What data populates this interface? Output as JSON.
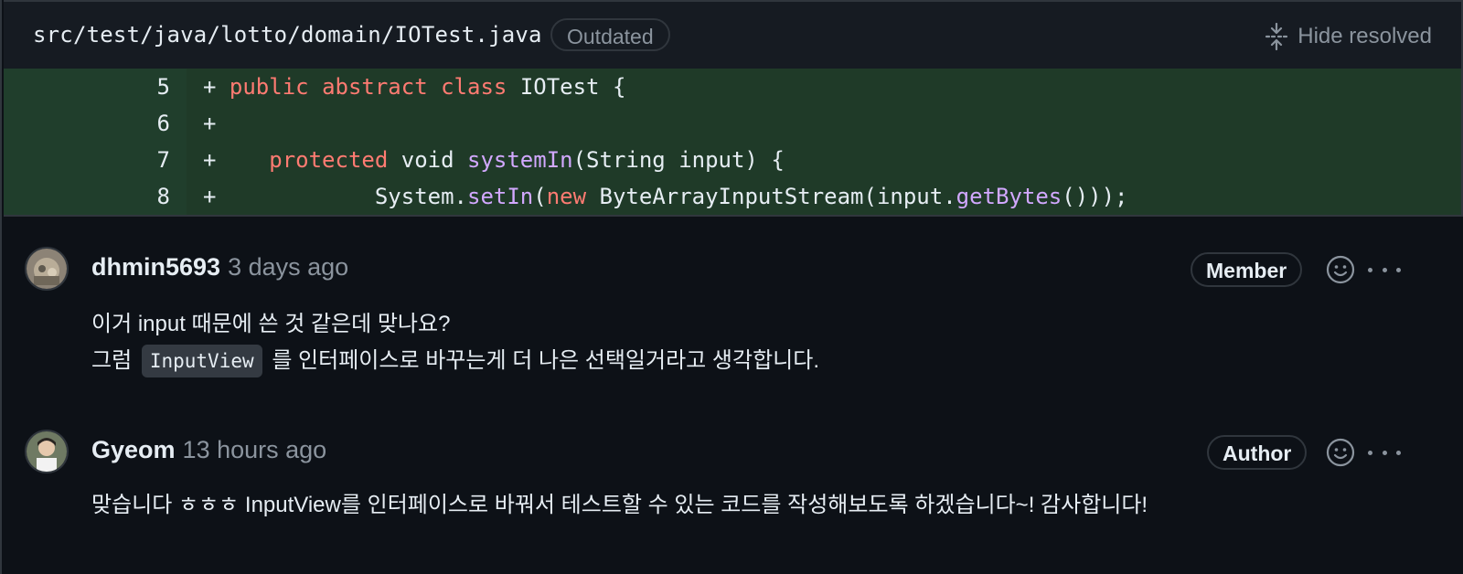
{
  "file": {
    "path": "src/test/java/lotto/domain/IOTest.java",
    "status_badge": "Outdated",
    "hide_resolved_label": "Hide resolved"
  },
  "diff": {
    "lines": [
      {
        "number": "5",
        "marker": "+",
        "code": "public abstract class IOTest {"
      },
      {
        "number": "6",
        "marker": "+",
        "code": ""
      },
      {
        "number": "7",
        "marker": "+",
        "code": "    protected void systemIn(String input) {"
      },
      {
        "number": "8",
        "marker": "+",
        "code": "            System.setIn(new ByteArrayInputStream(input.getBytes()));"
      }
    ]
  },
  "comments": [
    {
      "author": "dhmin5693",
      "time": "3 days ago",
      "role": "Member",
      "line1": "이거 input 때문에 쓴 것 같은데 맞나요?",
      "line2_prefix": "그럼",
      "line2_code": "InputView",
      "line2_suffix": "를 인터페이스로 바꾸는게 더 나은 선택일거라고 생각합니다."
    },
    {
      "author": "Gyeom",
      "time": "13 hours ago",
      "role": "Author",
      "line1": "맞습니다 ㅎㅎㅎ InputView를 인터페이스로 바꿔서 테스트할 수 있는 코드를 작성해보도록 하겠습니다~! 감사합니다!"
    }
  ],
  "colors": {
    "background": "#0d1117",
    "diff_added": "#1f3a28",
    "keyword": "#ff7b72",
    "function": "#d2a8ff",
    "muted": "#8b949e"
  }
}
